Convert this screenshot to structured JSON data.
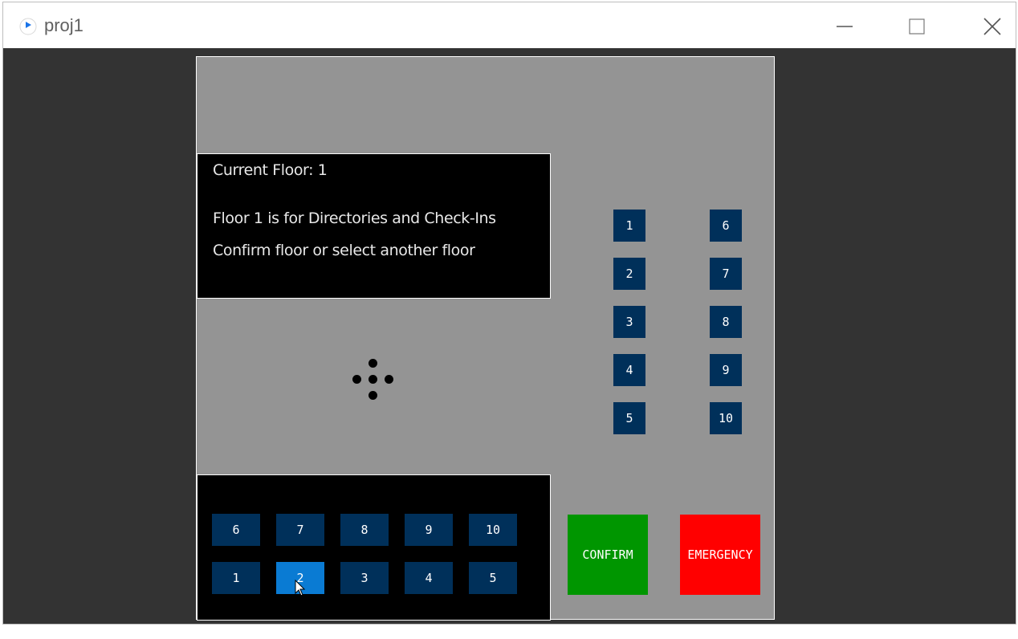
{
  "window": {
    "title": "proj1",
    "icons": [
      "app-icon",
      "minimize-icon",
      "maximize-icon",
      "close-icon"
    ]
  },
  "info": {
    "current_floor": "Current Floor: 1",
    "description": "Floor 1 is for Directories and Check-Ins",
    "prompt": "Confirm floor or select another floor"
  },
  "right_buttons": {
    "left_column": [
      "1",
      "2",
      "3",
      "4",
      "5"
    ],
    "right_column": [
      "6",
      "7",
      "8",
      "9",
      "10"
    ]
  },
  "keypad": {
    "top_row": [
      "6",
      "7",
      "8",
      "9",
      "10"
    ],
    "bottom_row": [
      "1",
      "2",
      "3",
      "4",
      "5"
    ],
    "selected": "2"
  },
  "actions": {
    "confirm": "CONFIRM",
    "emergency": "EMERGENCY"
  },
  "colors": {
    "background": "#949494",
    "floor_button": "#00305a",
    "selected_button": "#0a7bd3",
    "confirm": "#009600",
    "emergency": "#ff0000"
  }
}
